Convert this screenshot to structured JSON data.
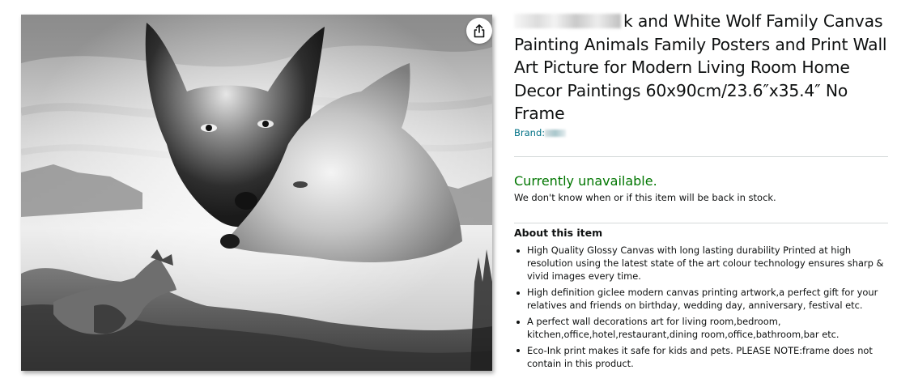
{
  "product": {
    "title_visible": "k and White Wolf Family Canvas Painting Animals Family Posters and Print Wall Art Picture for Modern Living Room Home Decor Paintings 60x90cm/23.6″x35.4″ No Frame",
    "brand_label": "Brand:",
    "image_alt": "Black and white wolf family canvas painting",
    "share_icon": "share-icon"
  },
  "availability": {
    "status": "Currently unavailable.",
    "note": "We don't know when or if this item will be back in stock.",
    "status_color": "#007600"
  },
  "about": {
    "heading": "About this item",
    "bullets": [
      "High Quality Glossy Canvas with long lasting durability Printed at high resolution using the latest state of the art colour technology ensures sharp & vivid images every time.",
      "High definition giclee modern canvas printing artwork,a perfect gift for your relatives and friends on birthday, wedding day, anniversary, festival etc.",
      "A perfect wall decorations art for living room,bedroom, kitchen,office,hotel,restaurant,dining room,office,bathroom,bar etc.",
      "Eco-Ink print makes it safe for kids and pets. PLEASE NOTE:frame does not contain in this product."
    ]
  },
  "colors": {
    "link": "#007185",
    "text": "#0f1111",
    "divider": "#d5d9d9"
  }
}
